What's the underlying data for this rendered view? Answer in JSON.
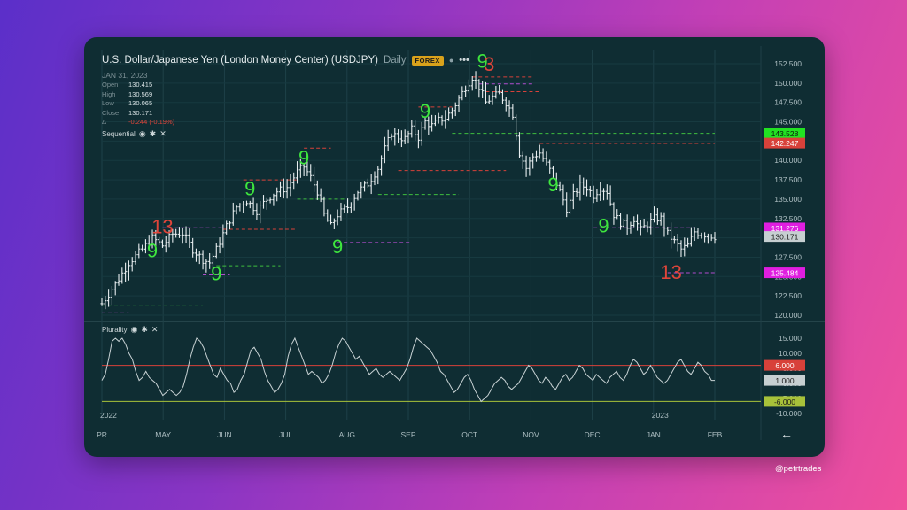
{
  "header": {
    "title": "U.S. Dollar/Japanese Yen (London Money Center) (USDJPY)",
    "interval": "Daily",
    "badge": "FOREX",
    "date": "JAN 31, 2023"
  },
  "ohlc": {
    "open_label": "Open",
    "open": "130.415",
    "high_label": "High",
    "high": "130.569",
    "low_label": "Low",
    "low": "130.065",
    "close_label": "Close",
    "close": "130.171",
    "change_label": "Δ",
    "change": "-0.244 (-0.19%)"
  },
  "indicators": {
    "sequential": "Sequential",
    "plurality": "Plurality"
  },
  "watermark": "@petrtrades",
  "colors": {
    "background": "#0f2d33",
    "bar": "#e8eef0",
    "setup_green": "#3ee63e",
    "countdown_red": "#e0453a",
    "support_green": "#3fbf3f",
    "resistance_red": "#d8413a",
    "purple": "#b24ccf",
    "osc_line": "#c8d2d4"
  },
  "chart_data": [
    {
      "type": "ohlc",
      "title": "U.S. Dollar/Japanese Yen (London Money Center) (USDJPY)",
      "x_labels": [
        "PR",
        "MAY",
        "JUN",
        "JUL",
        "AUG",
        "SEP",
        "OCT",
        "NOV",
        "DEC",
        "JAN",
        "FEB"
      ],
      "year_labels": [
        {
          "label": "2022",
          "at": "PR"
        },
        {
          "label": "2023",
          "at": "JAN"
        }
      ],
      "ylim": [
        120.0,
        152.5
      ],
      "y_ticks": [
        "152.500",
        "150.000",
        "147.500",
        "145.000",
        "142.500",
        "140.000",
        "137.500",
        "135.000",
        "132.500",
        "130.000",
        "127.500",
        "125.000",
        "122.500",
        "120.000"
      ],
      "price_path": [
        [
          0,
          121.5
        ],
        [
          4,
          124.0
        ],
        [
          8,
          126.8
        ],
        [
          12,
          128.5
        ],
        [
          15,
          130.0
        ],
        [
          18,
          129.0
        ],
        [
          21,
          130.5
        ],
        [
          24,
          130.6
        ],
        [
          27,
          128.5
        ],
        [
          30,
          127.2
        ],
        [
          32,
          126.8
        ],
        [
          34,
          128.5
        ],
        [
          37,
          131.5
        ],
        [
          40,
          134.0
        ],
        [
          43,
          134.8
        ],
        [
          46,
          133.5
        ],
        [
          49,
          135.0
        ],
        [
          52,
          136.0
        ],
        [
          55,
          136.5
        ],
        [
          58,
          138.5
        ],
        [
          60,
          139.2
        ],
        [
          62,
          137.8
        ],
        [
          64,
          136.0
        ],
        [
          66,
          133.0
        ],
        [
          68,
          131.5
        ],
        [
          70,
          133.0
        ],
        [
          73,
          134.0
        ],
        [
          76,
          136.0
        ],
        [
          79,
          137.0
        ],
        [
          82,
          139.0
        ],
        [
          84,
          141.5
        ],
        [
          86,
          143.5
        ],
        [
          88,
          143.0
        ],
        [
          90,
          142.8
        ],
        [
          92,
          144.0
        ],
        [
          94,
          143.0
        ],
        [
          96,
          145.0
        ],
        [
          98,
          144.5
        ],
        [
          100,
          145.2
        ],
        [
          102,
          145.5
        ],
        [
          104,
          146.5
        ],
        [
          106,
          148.0
        ],
        [
          108,
          149.5
        ],
        [
          110,
          150.8
        ],
        [
          112,
          149.5
        ],
        [
          114,
          147.5
        ],
        [
          116,
          148.2
        ],
        [
          118,
          148.6
        ],
        [
          120,
          147.5
        ],
        [
          122,
          146.0
        ],
        [
          124,
          141.0
        ],
        [
          126,
          139.0
        ],
        [
          128,
          140.5
        ],
        [
          130,
          141.0
        ],
        [
          132,
          139.5
        ],
        [
          134,
          138.0
        ],
        [
          136,
          136.0
        ],
        [
          138,
          133.8
        ],
        [
          140,
          135.5
        ],
        [
          142,
          136.8
        ],
        [
          144,
          136.5
        ],
        [
          146,
          135.5
        ],
        [
          148,
          136.5
        ],
        [
          150,
          136.0
        ],
        [
          152,
          133.0
        ],
        [
          154,
          132.0
        ],
        [
          156,
          131.5
        ],
        [
          158,
          132.5
        ],
        [
          160,
          131.0
        ],
        [
          162,
          131.8
        ],
        [
          164,
          132.5
        ],
        [
          166,
          132.5
        ],
        [
          168,
          130.5
        ],
        [
          170,
          129.5
        ],
        [
          172,
          128.5
        ],
        [
          174,
          129.0
        ],
        [
          176,
          130.8
        ],
        [
          178,
          130.5
        ],
        [
          180,
          130.4
        ],
        [
          182,
          130.17
        ]
      ],
      "markers": [
        {
          "label": "13",
          "color": "red",
          "x": 18,
          "y": 130.6
        },
        {
          "label": "9",
          "color": "green",
          "x": 15,
          "y": 127.5
        },
        {
          "label": "9",
          "color": "green",
          "x": 34,
          "y": 124.5
        },
        {
          "label": "9",
          "color": "green",
          "x": 44,
          "y": 135.5
        },
        {
          "label": "9",
          "color": "green",
          "x": 60,
          "y": 139.5
        },
        {
          "label": "9",
          "color": "green",
          "x": 70,
          "y": 128.0
        },
        {
          "label": "9",
          "color": "green",
          "x": 96,
          "y": 145.5
        },
        {
          "label": "9",
          "color": "green",
          "x": 113,
          "y": 152.0
        },
        {
          "label": "3",
          "color": "red",
          "x": 115,
          "y": 151.6
        },
        {
          "label": "9",
          "color": "green",
          "x": 134,
          "y": 136.0
        },
        {
          "label": "9",
          "color": "green",
          "x": 149,
          "y": 130.7
        },
        {
          "label": "13",
          "color": "red",
          "x": 169,
          "y": 124.7
        }
      ],
      "levels": [
        {
          "color": "green",
          "value": 121.3,
          "from": 0,
          "to": 30
        },
        {
          "color": "purple",
          "value": 120.3,
          "from": 0,
          "to": 8
        },
        {
          "color": "purple",
          "value": 131.3,
          "from": 18,
          "to": 36
        },
        {
          "color": "red",
          "value": 131.1,
          "from": 36,
          "to": 58
        },
        {
          "color": "green",
          "value": 126.4,
          "from": 34,
          "to": 53
        },
        {
          "color": "purple",
          "value": 125.2,
          "from": 30,
          "to": 38
        },
        {
          "color": "red",
          "value": 137.5,
          "from": 42,
          "to": 58
        },
        {
          "color": "red",
          "value": 141.6,
          "from": 60,
          "to": 68
        },
        {
          "color": "green",
          "value": 135.0,
          "from": 58,
          "to": 72
        },
        {
          "color": "purple",
          "value": 129.4,
          "from": 70,
          "to": 92
        },
        {
          "color": "red",
          "value": 146.9,
          "from": 94,
          "to": 104
        },
        {
          "color": "green",
          "value": 135.6,
          "from": 82,
          "to": 106
        },
        {
          "color": "red",
          "value": 138.7,
          "from": 88,
          "to": 120
        },
        {
          "color": "red",
          "value": 150.8,
          "from": 110,
          "to": 128
        },
        {
          "color": "purple",
          "value": 149.9,
          "from": 112,
          "to": 128
        },
        {
          "color": "red",
          "value": 148.9,
          "from": 114,
          "to": 130
        },
        {
          "color": "green",
          "value": 143.5,
          "from": 104,
          "to": 182
        },
        {
          "color": "red",
          "value": 142.2,
          "from": 130,
          "to": 182
        },
        {
          "color": "purple",
          "value": 131.3,
          "from": 146,
          "to": 176
        },
        {
          "color": "purple",
          "value": 125.5,
          "from": 168,
          "to": 182
        }
      ],
      "price_tags": [
        {
          "label": "143.528",
          "value": 143.528,
          "color": "#22e222",
          "text_color": "#0b1a0b"
        },
        {
          "label": "142.247",
          "value": 142.247,
          "color": "#d8413a",
          "text_color": "#ffffff"
        },
        {
          "label": "131.276",
          "value": 131.276,
          "color": "#e01ee0",
          "text_color": "#ffffff"
        },
        {
          "label": "130.171",
          "value": 130.171,
          "color": "#c7cfd1",
          "text_color": "#1a1a1a"
        },
        {
          "label": "125.484",
          "value": 125.484,
          "color": "#e01ee0",
          "text_color": "#ffffff"
        }
      ]
    },
    {
      "type": "line",
      "title": "Plurality",
      "ylim": [
        -10.0,
        15.0
      ],
      "y_ticks": [
        "15.000",
        "10.000",
        "5.000",
        "0.000",
        "-5.000",
        "-10.000"
      ],
      "reference_lines": [
        {
          "value": 6.0,
          "color": "#d8413a"
        },
        {
          "value": -6.0,
          "color": "#a8c23a"
        }
      ],
      "value_tags": [
        {
          "label": "6.000",
          "value": 6.0,
          "color": "#d8413a",
          "text_color": "#ffffff"
        },
        {
          "label": "1.000",
          "value": 1.0,
          "color": "#c7cfd1",
          "text_color": "#1a1a1a"
        },
        {
          "label": "-6.000",
          "value": -6.0,
          "color": "#a8c23a",
          "text_color": "#1a1a1a"
        }
      ],
      "values": [
        1,
        3,
        8,
        14,
        15,
        14,
        15,
        13,
        10,
        8,
        4,
        1,
        2,
        4,
        2,
        1,
        0,
        -2,
        -4,
        -3,
        -2,
        -3,
        -4,
        -3,
        -1,
        3,
        8,
        12,
        15,
        14,
        12,
        9,
        6,
        3,
        2,
        5,
        3,
        1,
        0,
        -3,
        -2,
        1,
        3,
        7,
        11,
        12,
        10,
        8,
        4,
        1,
        -1,
        -3,
        -2,
        0,
        3,
        9,
        13,
        15,
        12,
        9,
        6,
        3,
        4,
        3,
        2,
        0,
        1,
        3,
        6,
        10,
        13,
        15,
        14,
        12,
        10,
        8,
        9,
        7,
        5,
        3,
        4,
        5,
        3,
        2,
        3,
        4,
        3,
        2,
        1,
        3,
        5,
        8,
        12,
        15,
        14,
        13,
        12,
        11,
        9,
        7,
        4,
        3,
        1,
        -1,
        -3,
        -2,
        0,
        2,
        3,
        1,
        -2,
        -4,
        -6,
        -5,
        -4,
        -2,
        0,
        1,
        2,
        1,
        -1,
        -2,
        -1,
        0,
        2,
        4,
        6,
        5,
        3,
        1,
        0,
        2,
        1,
        -1,
        -2,
        0,
        2,
        3,
        1,
        2,
        4,
        6,
        5,
        3,
        2,
        1,
        3,
        2,
        1,
        0,
        2,
        3,
        4,
        2,
        1,
        3,
        6,
        8,
        7,
        5,
        3,
        4,
        6,
        4,
        2,
        1,
        0,
        1,
        3,
        5,
        7,
        8,
        6,
        4,
        3,
        5,
        7,
        6,
        4,
        3,
        1,
        1
      ]
    }
  ]
}
